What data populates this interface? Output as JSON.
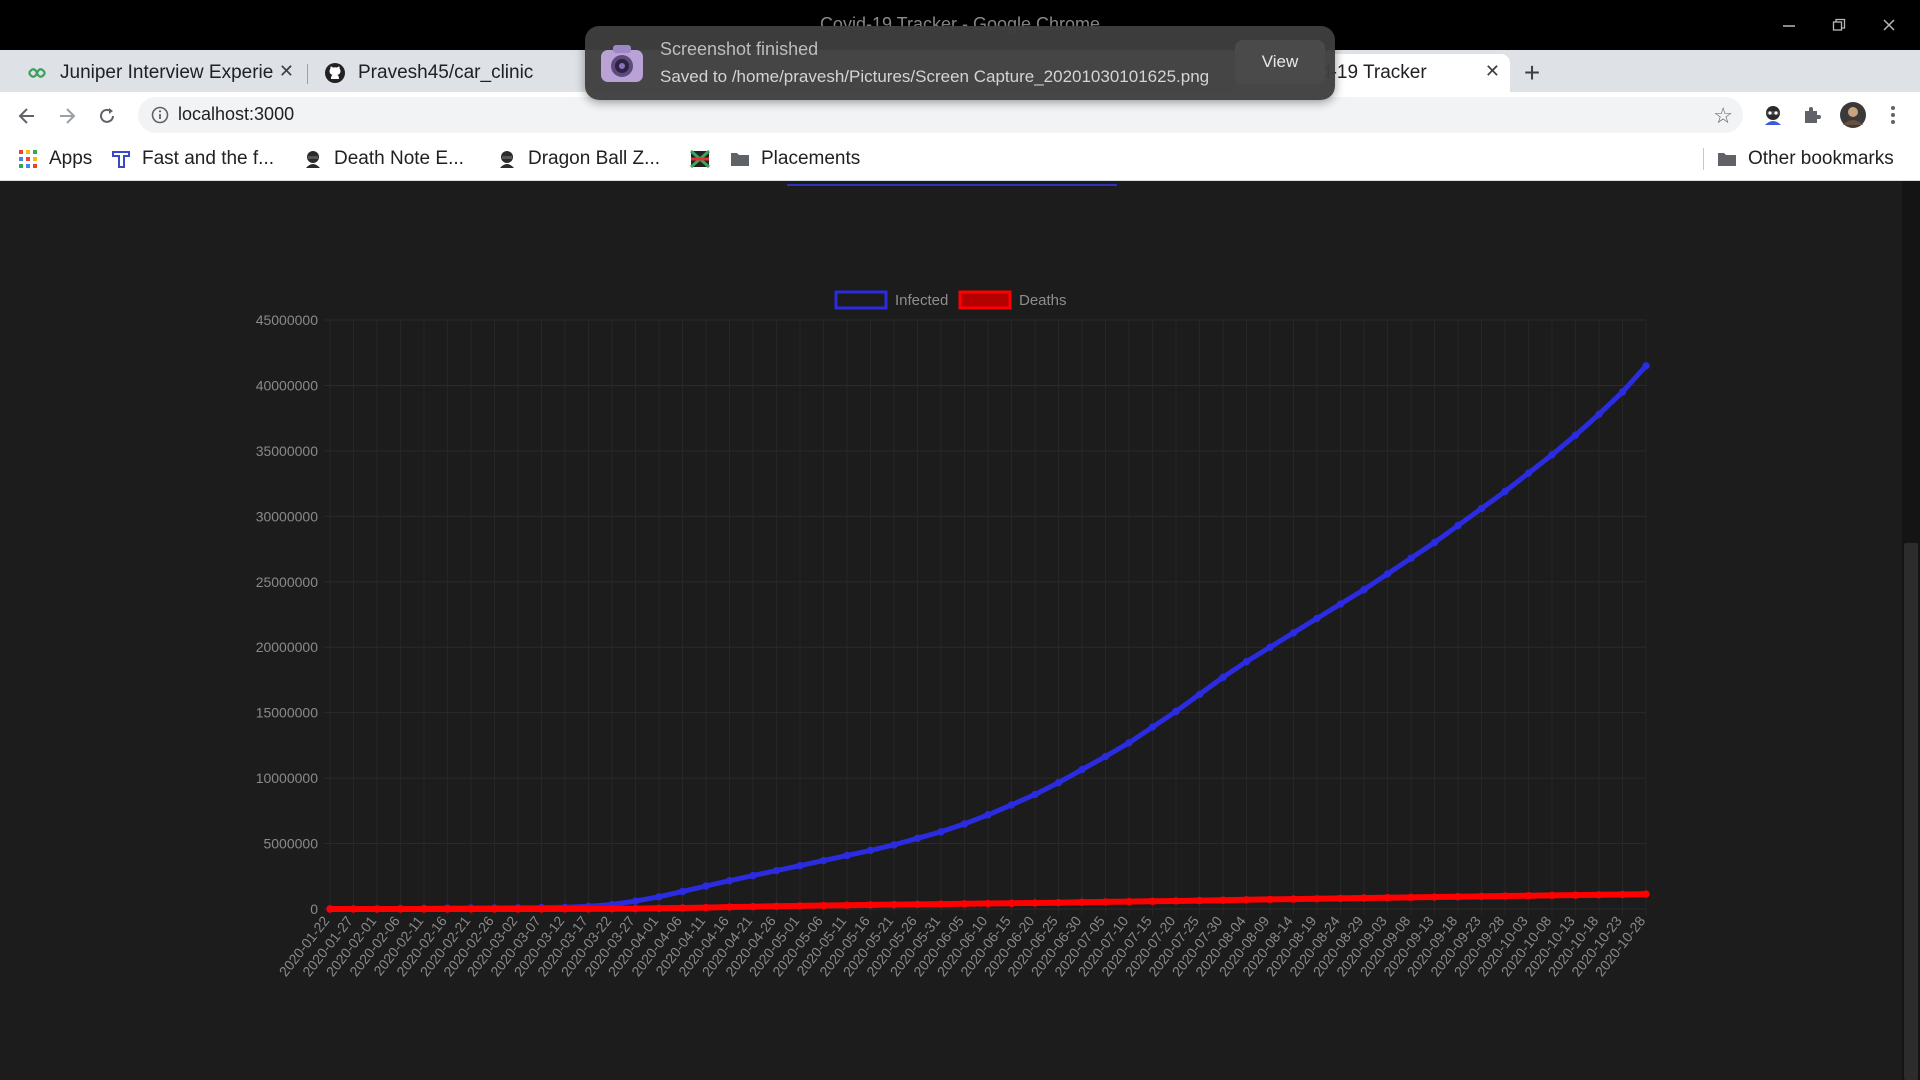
{
  "window": {
    "title": "Covid-19 Tracker - Google Chrome",
    "controls": [
      "minimize",
      "restore",
      "close"
    ]
  },
  "tabs": [
    {
      "label": "Juniper Interview Experie",
      "icon": "juniper-icon"
    },
    {
      "label": "Pravesh45/car_clinic",
      "icon": "github-icon"
    },
    {
      "label": "Covid-19 Tracker",
      "icon": "react-icon",
      "active": true
    }
  ],
  "address_bar": {
    "url": "localhost:3000"
  },
  "bookmarks": [
    {
      "label": "Apps",
      "icon": "apps-grid-icon"
    },
    {
      "label": "Fast and the f...",
      "icon": "tutorial-icon"
    },
    {
      "label": "Death Note E...",
      "icon": "anime-icon"
    },
    {
      "label": "Dragon Ball Z...",
      "icon": "anime-icon"
    },
    {
      "label": "",
      "icon": "flag-icon"
    },
    {
      "label": "Placements",
      "icon": "folder-icon"
    },
    {
      "label": "Other bookmarks",
      "icon": "folder-icon"
    }
  ],
  "notification": {
    "title": "Screenshot finished",
    "body": "Saved to /home/pravesh/Pictures/Screen Capture_20201030101625.png",
    "action": "View"
  },
  "colors": {
    "infected": "#2b2be0",
    "deaths": "#ff0000",
    "background": "#1c1c1c"
  },
  "chart_data": {
    "type": "line",
    "title": "",
    "xlabel": "",
    "ylabel": "",
    "ylim": [
      0,
      45000000
    ],
    "yticks": [
      0,
      5000000,
      10000000,
      15000000,
      20000000,
      25000000,
      30000000,
      35000000,
      40000000,
      45000000
    ],
    "grid": true,
    "legend_position": "top",
    "x_tick_labels": [
      "2020-01-22",
      "2020-01-27",
      "2020-02-01",
      "2020-02-06",
      "2020-02-11",
      "2020-02-16",
      "2020-02-21",
      "2020-02-26",
      "2020-03-02",
      "2020-03-07",
      "2020-03-12",
      "2020-03-17",
      "2020-03-22",
      "2020-03-27",
      "2020-04-01",
      "2020-04-06",
      "2020-04-11",
      "2020-04-16",
      "2020-04-21",
      "2020-04-26",
      "2020-05-01",
      "2020-05-06",
      "2020-05-11",
      "2020-05-16",
      "2020-05-21",
      "2020-05-26",
      "2020-05-31",
      "2020-06-05",
      "2020-06-10",
      "2020-06-15",
      "2020-06-20",
      "2020-06-25",
      "2020-06-30",
      "2020-07-05",
      "2020-07-10",
      "2020-07-15",
      "2020-07-20",
      "2020-07-25",
      "2020-07-30",
      "2020-08-04",
      "2020-08-09",
      "2020-08-14",
      "2020-08-19",
      "2020-08-24",
      "2020-08-29",
      "2020-09-03",
      "2020-09-08",
      "2020-09-13",
      "2020-09-18",
      "2020-09-23",
      "2020-09-28",
      "2020-10-03",
      "2020-10-08",
      "2020-10-13",
      "2020-10-18",
      "2020-10-23",
      "2020-10-28"
    ],
    "x": [
      "2020-01-22",
      "2020-01-27",
      "2020-02-01",
      "2020-02-06",
      "2020-02-11",
      "2020-02-16",
      "2020-02-21",
      "2020-02-26",
      "2020-03-02",
      "2020-03-07",
      "2020-03-12",
      "2020-03-17",
      "2020-03-22",
      "2020-03-27",
      "2020-04-01",
      "2020-04-06",
      "2020-04-11",
      "2020-04-16",
      "2020-04-21",
      "2020-04-26",
      "2020-05-01",
      "2020-05-06",
      "2020-05-11",
      "2020-05-16",
      "2020-05-21",
      "2020-05-26",
      "2020-05-31",
      "2020-06-05",
      "2020-06-10",
      "2020-06-15",
      "2020-06-20",
      "2020-06-25",
      "2020-06-30",
      "2020-07-05",
      "2020-07-10",
      "2020-07-15",
      "2020-07-20",
      "2020-07-25",
      "2020-07-30",
      "2020-08-04",
      "2020-08-09",
      "2020-08-14",
      "2020-08-19",
      "2020-08-24",
      "2020-08-29",
      "2020-09-03",
      "2020-09-08",
      "2020-09-13",
      "2020-09-18",
      "2020-09-23",
      "2020-09-28",
      "2020-10-03",
      "2020-10-08",
      "2020-10-13",
      "2020-10-18",
      "2020-10-23",
      "2020-10-28"
    ],
    "series": [
      {
        "name": "Infected",
        "values": [
          600,
          2900,
          12000,
          28000,
          43000,
          69000,
          77000,
          81000,
          90000,
          105000,
          128000,
          198000,
          340000,
          600000,
          930000,
          1340000,
          1760000,
          2160000,
          2550000,
          2930000,
          3310000,
          3700000,
          4090000,
          4480000,
          4900000,
          5400000,
          5900000,
          6500000,
          7200000,
          7950000,
          8750000,
          9650000,
          10650000,
          11650000,
          12700000,
          13900000,
          15100000,
          16400000,
          17700000,
          18900000,
          20000000,
          21100000,
          22200000,
          23300000,
          24400000,
          25600000,
          26800000,
          28000000,
          29300000,
          30600000,
          31900000,
          33300000,
          34700000,
          36200000,
          37800000,
          39500000,
          41500000
        ]
      },
      {
        "name": "Deaths",
        "values": [
          17,
          80,
          260,
          640,
          1100,
          1700,
          2300,
          2800,
          3100,
          3600,
          5000,
          8000,
          15000,
          27000,
          50000,
          80000,
          110000,
          150000,
          175000,
          205000,
          235000,
          265000,
          288000,
          310000,
          335000,
          355000,
          375000,
          395000,
          417000,
          440000,
          460000,
          485000,
          515000,
          540000,
          565000,
          590000,
          615000,
          640000,
          670000,
          700000,
          730000,
          755000,
          780000,
          810000,
          840000,
          865000,
          890000,
          915000,
          940000,
          965000,
          990000,
          1015000,
          1040000,
          1060000,
          1085000,
          1110000,
          1140000
        ]
      }
    ]
  }
}
